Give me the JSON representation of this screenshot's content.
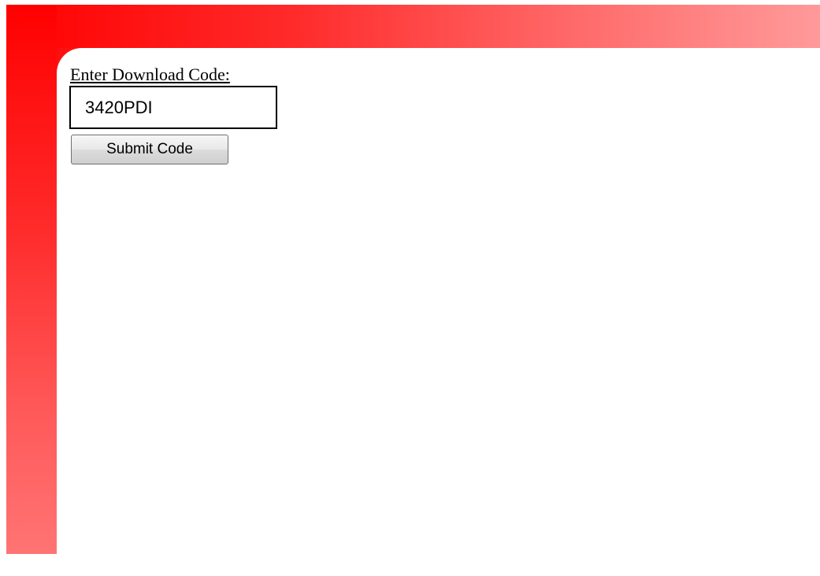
{
  "form": {
    "label": "Enter Download Code:",
    "code_value": "3420PDI",
    "submit_label": "Submit Code"
  },
  "colors": {
    "frame_red": "#ff0000",
    "frame_light": "#ff9a9a",
    "panel_background": "#ffffff"
  }
}
